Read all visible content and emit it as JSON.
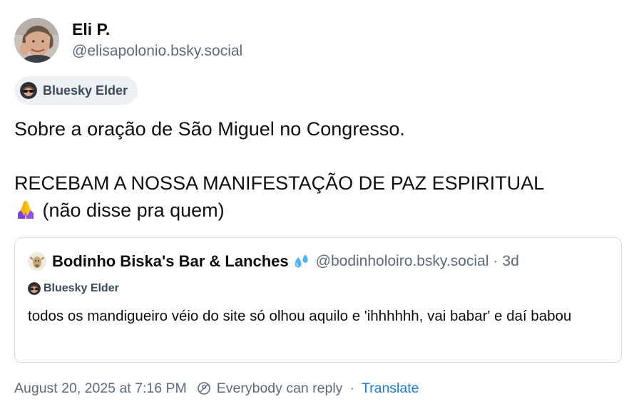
{
  "author": {
    "display_name": "Eli P.",
    "handle": "@elisapolonio.bsky.social",
    "avatar_icon": "user-avatar-photo"
  },
  "badge": {
    "label": "Bluesky Elder",
    "icon": "elder-badge-icon"
  },
  "post": {
    "line1": "Sobre a oração de São Miguel no Congresso.",
    "line2": "RECEBAM A NOSSA MANIFESTAÇÃO DE PAZ ESPIRITUAL",
    "line3": "(não disse pra quem)",
    "emoji": "folded-hands-emoji"
  },
  "quote": {
    "display_name": "Bodinho Biska's Bar & Lanches",
    "name_emoji": "sweat-droplets-emoji",
    "handle": "@bodinholoiro.bsky.social",
    "separator": "·",
    "time": "3d",
    "badge_label": "Bluesky Elder",
    "text": "todos os mandigueiro véio do site só olhou aquilo e 'ihhhhhh, vai babar' e daí babou"
  },
  "meta": {
    "timestamp": "August 20, 2025 at 7:16 PM",
    "reply_setting": "Everybody can reply",
    "separator": "·",
    "translate": "Translate"
  },
  "colors": {
    "link": "#1d7ae0",
    "muted": "#5b6b7c",
    "badge_bg": "#eef1f4",
    "border": "#d4dbe2"
  }
}
